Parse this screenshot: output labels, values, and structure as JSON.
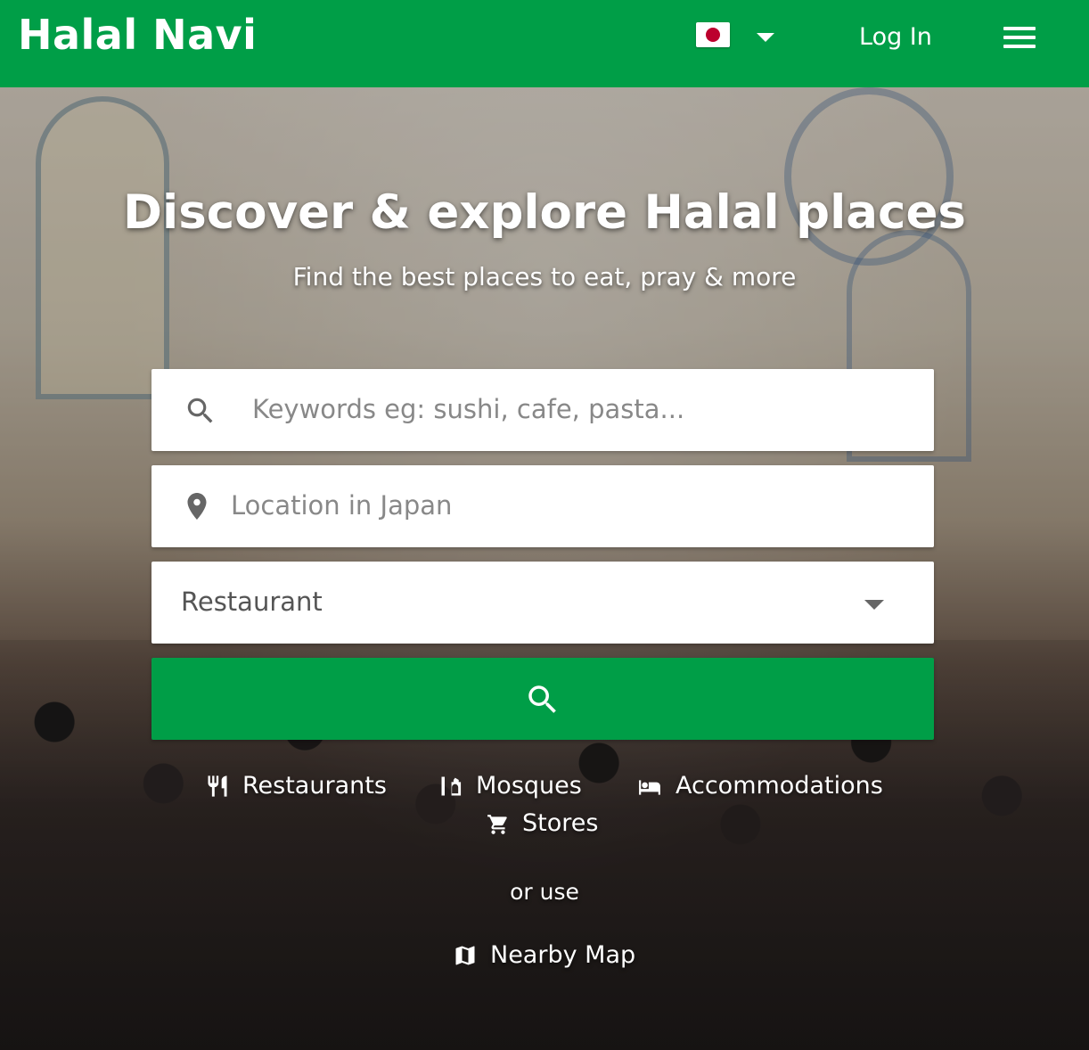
{
  "header": {
    "logo": "Halal Navi",
    "login_label": "Log In",
    "language_flag": "japan-flag",
    "brand_color": "#009e47"
  },
  "hero": {
    "title": "Discover & explore Halal places",
    "subtitle": "Find the best places to eat, pray & more"
  },
  "search": {
    "keyword_placeholder": "Keywords eg: sushi, cafe, pasta...",
    "location_placeholder": "Location in Japan",
    "category_selected": "Restaurant"
  },
  "quick_links": [
    {
      "label": "Restaurants",
      "icon": "fork-knife-icon"
    },
    {
      "label": "Mosques",
      "icon": "mosque-icon"
    },
    {
      "label": "Accommodations",
      "icon": "bed-icon"
    },
    {
      "label": "Stores",
      "icon": "cart-icon"
    }
  ],
  "or_use": "or use",
  "nearby_map": {
    "label": "Nearby Map",
    "icon": "map-icon"
  }
}
